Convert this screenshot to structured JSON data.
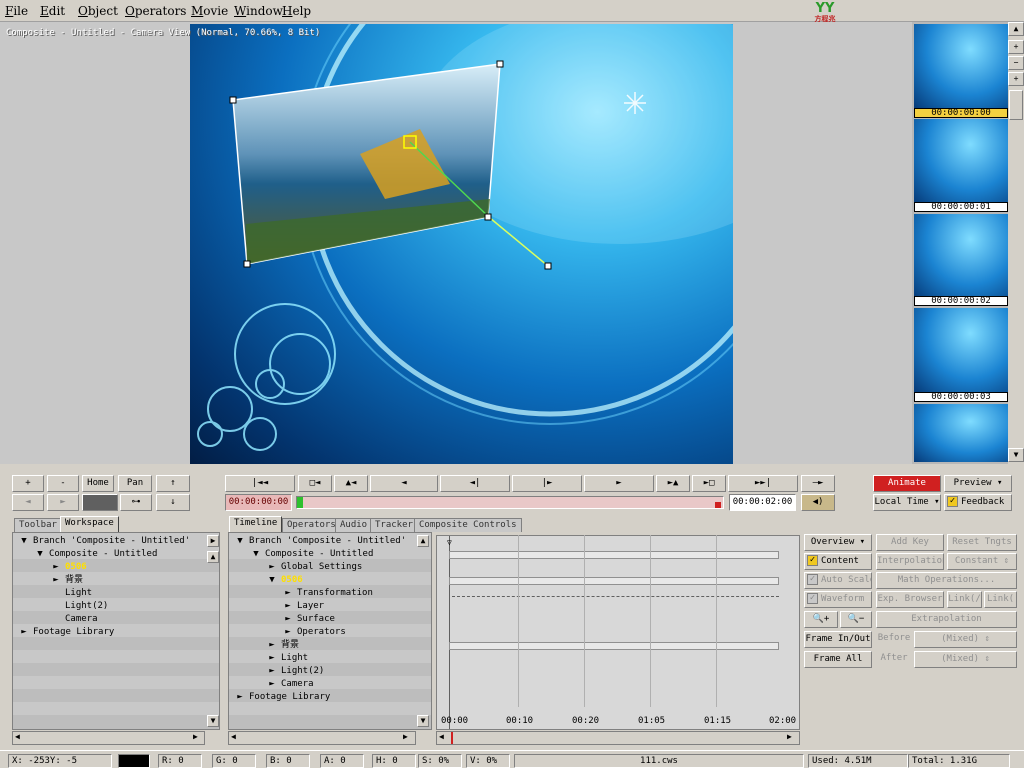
{
  "menu": [
    "File",
    "Edit",
    "Object",
    "Operators",
    "Movie",
    "Window",
    "Help"
  ],
  "logo": {
    "text": "YY",
    "sub": "方程兆"
  },
  "viewer": {
    "title": "Composite - Untitled - Camera View (Normal, 70.66%, 8 Bit)"
  },
  "thumbnails": [
    "00:00:00:00",
    "00:00:00:01",
    "00:00:00:02",
    "00:00:00:03"
  ],
  "transport": {
    "left_row1": [
      "+",
      "-",
      "Home",
      "Pan",
      "↑"
    ],
    "left_row2": [
      "◄",
      "►",
      "",
      "↓"
    ],
    "play_buttons": [
      "|◄◄",
      "□◄",
      "▲◄",
      "◄",
      "◄|",
      "|►",
      "►",
      "►▲",
      "►□",
      "►►|",
      "—►"
    ],
    "current_time": "00:00:00:00",
    "end_time": "00:00:02:00",
    "animate": "Animate",
    "preview": "Preview",
    "local_time": "Local Time",
    "feedback": "Feedback"
  },
  "left_tabs": [
    "Toolbar",
    "Workspace"
  ],
  "workspace_tree": [
    {
      "indent": 0,
      "icon": "▼",
      "label": "Branch 'Composite - Untitled'"
    },
    {
      "indent": 1,
      "icon": "▼",
      "label": "Composite - Untitled"
    },
    {
      "indent": 2,
      "icon": "►",
      "label": "0506",
      "highlight": true
    },
    {
      "indent": 2,
      "icon": "►",
      "label": "背景"
    },
    {
      "indent": 2,
      "icon": "",
      "label": "Light"
    },
    {
      "indent": 2,
      "icon": "",
      "label": "Light(2)"
    },
    {
      "indent": 2,
      "icon": "",
      "label": "Camera"
    },
    {
      "indent": 0,
      "icon": "►",
      "label": "Footage Library"
    }
  ],
  "timeline_tabs": [
    "Timeline",
    "Operators",
    "Audio",
    "Tracker",
    "Composite Controls"
  ],
  "timeline_tree": [
    {
      "indent": 0,
      "icon": "▼",
      "label": "Branch 'Composite - Untitled'"
    },
    {
      "indent": 1,
      "icon": "▼",
      "label": "Composite - Untitled"
    },
    {
      "indent": 2,
      "icon": "►",
      "label": "Global Settings"
    },
    {
      "indent": 2,
      "icon": "▼",
      "label": "0506",
      "highlight": true
    },
    {
      "indent": 3,
      "icon": "►",
      "label": "Transformation"
    },
    {
      "indent": 3,
      "icon": "►",
      "label": "Layer"
    },
    {
      "indent": 3,
      "icon": "►",
      "label": "Surface"
    },
    {
      "indent": 3,
      "icon": "►",
      "label": "Operators"
    },
    {
      "indent": 2,
      "icon": "►",
      "label": "背景"
    },
    {
      "indent": 2,
      "icon": "►",
      "label": "Light"
    },
    {
      "indent": 2,
      "icon": "►",
      "label": "Light(2)"
    },
    {
      "indent": 2,
      "icon": "►",
      "label": "Camera"
    },
    {
      "indent": 0,
      "icon": "►",
      "label": "Footage Library"
    }
  ],
  "timeline_ticks": [
    "00:00",
    "00:10",
    "00:20",
    "01:05",
    "01:15",
    "02:00"
  ],
  "controls": {
    "overview": "Overview",
    "add_key": "Add Key",
    "reset_tngts": "Reset Tngts",
    "content": "Content",
    "interpolation": "Interpolation",
    "constant": "Constant",
    "auto_scale": "Auto Scale",
    "math_operations": "Math Operations...",
    "waveform": "Waveform",
    "exp_browser": "Exp. Browser",
    "link1": "Link(/",
    "link2": "Link(",
    "extrapolation": "Extrapolation",
    "frame_inout": "Frame In/Out",
    "frame_all": "Frame All",
    "before": "Before",
    "after": "After",
    "mixed1": "(Mixed)",
    "mixed2": "(Mixed)"
  },
  "status": {
    "x": "X:  -253Y:   -5",
    "r": "R: 0",
    "g": "G: 0",
    "b": "B: 0",
    "a": "A: 0",
    "h": "H: 0",
    "s": "S: 0%",
    "v": "V: 0%",
    "file": "111.cws",
    "used": "Used: 4.51M",
    "total": "Total: 1.31G"
  }
}
